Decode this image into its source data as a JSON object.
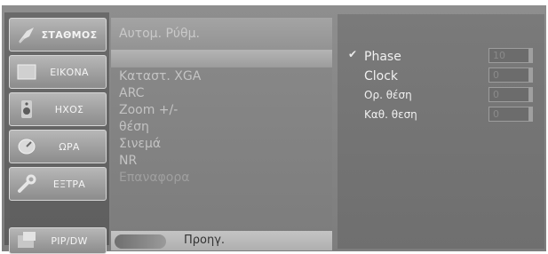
{
  "tabs": [
    {
      "label": "ΣΤΑΘΜΟΣ",
      "icon": "satellite-dish-icon",
      "name": "tab-station"
    },
    {
      "label": "ΕΙΚΟΝΑ",
      "icon": "picture-icon",
      "name": "tab-picture"
    },
    {
      "label": "ΗΧΟΣ",
      "icon": "speaker-icon",
      "name": "tab-sound"
    },
    {
      "label": "ΩΡΑ",
      "icon": "clock-icon",
      "name": "tab-time"
    },
    {
      "label": "ΕΞΤΡΑ",
      "icon": "wrench-icon",
      "name": "tab-extra"
    },
    {
      "label": "PIP/DW",
      "icon": "pip-icon",
      "name": "tab-pip"
    }
  ],
  "menu": {
    "selected": "Αυτομ. Ρύθμ.",
    "items": [
      "Καταστ. XGA",
      "ARC",
      "Zoom +/-",
      "θέση",
      "Σινεμά",
      "NR",
      "Επαναφορα"
    ],
    "prev_label": "Προηγ."
  },
  "panel": {
    "rows": [
      {
        "label": "Phase",
        "value": "10",
        "checked": true
      },
      {
        "label": "Clock",
        "value": "0",
        "checked": false
      },
      {
        "label": "Ορ. θέση",
        "value": "0",
        "checked": false
      },
      {
        "label": "Καθ. θεση",
        "value": "0",
        "checked": false
      }
    ],
    "check_glyph": "✔"
  },
  "colors": {
    "background": "#8e8e8e",
    "tab_face": "#a3a3a3",
    "text_light": "#f4f4f4"
  }
}
